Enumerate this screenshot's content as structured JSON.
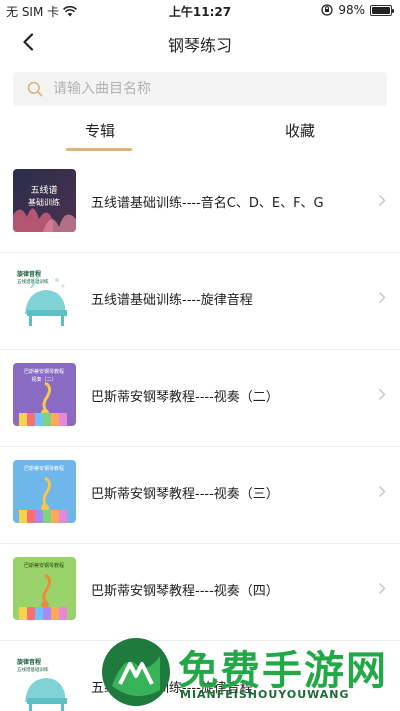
{
  "status_bar": {
    "carrier": "无 SIM 卡",
    "time": "上午11:27",
    "battery": "98%",
    "battery_level": 0.98
  },
  "nav": {
    "title": "钢琴练习",
    "back_icon": "chevron-left-icon"
  },
  "search": {
    "placeholder": "请输入曲目名称",
    "icon": "search-icon"
  },
  "tabs": [
    {
      "label": "专辑",
      "active": true
    },
    {
      "label": "收藏",
      "active": false
    }
  ],
  "items": [
    {
      "title": "五线谱基础训练----音名C、D、E、F、G",
      "thumb_text": [
        "五线谱",
        "基础训练"
      ],
      "thumb_style": "dark"
    },
    {
      "title": "五线谱基础训练----旋律音程",
      "thumb_text": [
        "旋律音程",
        "五线谱基础训练"
      ],
      "thumb_style": "piano"
    },
    {
      "title": "巴斯蒂安钢琴教程----视奏（二）",
      "thumb_text": [
        "巴斯蒂安钢琴教程",
        "视奏（二）"
      ],
      "thumb_style": "purple"
    },
    {
      "title": "巴斯蒂安钢琴教程----视奏（三）",
      "thumb_text": [
        "巴斯蒂安钢琴教程"
      ],
      "thumb_style": "blue"
    },
    {
      "title": "巴斯蒂安钢琴教程----视奏（四）",
      "thumb_text": [
        "巴斯蒂安钢琴教程"
      ],
      "thumb_style": "green"
    },
    {
      "title": "五线谱基础训练----旋律音程",
      "thumb_text": [
        "旋律音程",
        "五线谱基础训练"
      ],
      "thumb_style": "piano"
    }
  ],
  "watermark": {
    "text": "免费手游网",
    "subtext": "MIANFEISHOUYOUWANG"
  },
  "colors": {
    "accent": "#d9b57a",
    "search_bg": "#f3f3f3",
    "search_icon": "#d9b57a",
    "watermark_green": "#22a847"
  }
}
